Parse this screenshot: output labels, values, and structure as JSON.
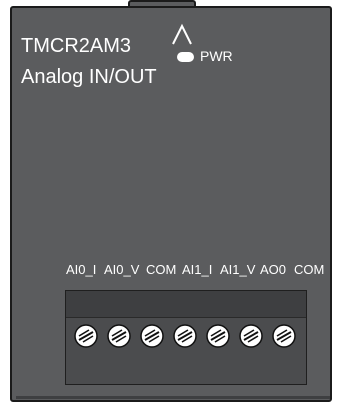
{
  "module": {
    "model": "TMCR2AM3",
    "description": "Analog IN/OUT",
    "power_label": "PWR",
    "terminals": [
      "AI0_I",
      "AI0_V",
      "COM",
      "AI1_I",
      "AI1_V",
      "AO0",
      "COM"
    ]
  },
  "colors": {
    "housing": "#5b5c5e",
    "outline": "#1b1b1b",
    "text": "#ffffff",
    "led": "#ffffff"
  },
  "icons": {
    "release_arrow": "chevron-up-icon",
    "screw": "screw-icon"
  }
}
